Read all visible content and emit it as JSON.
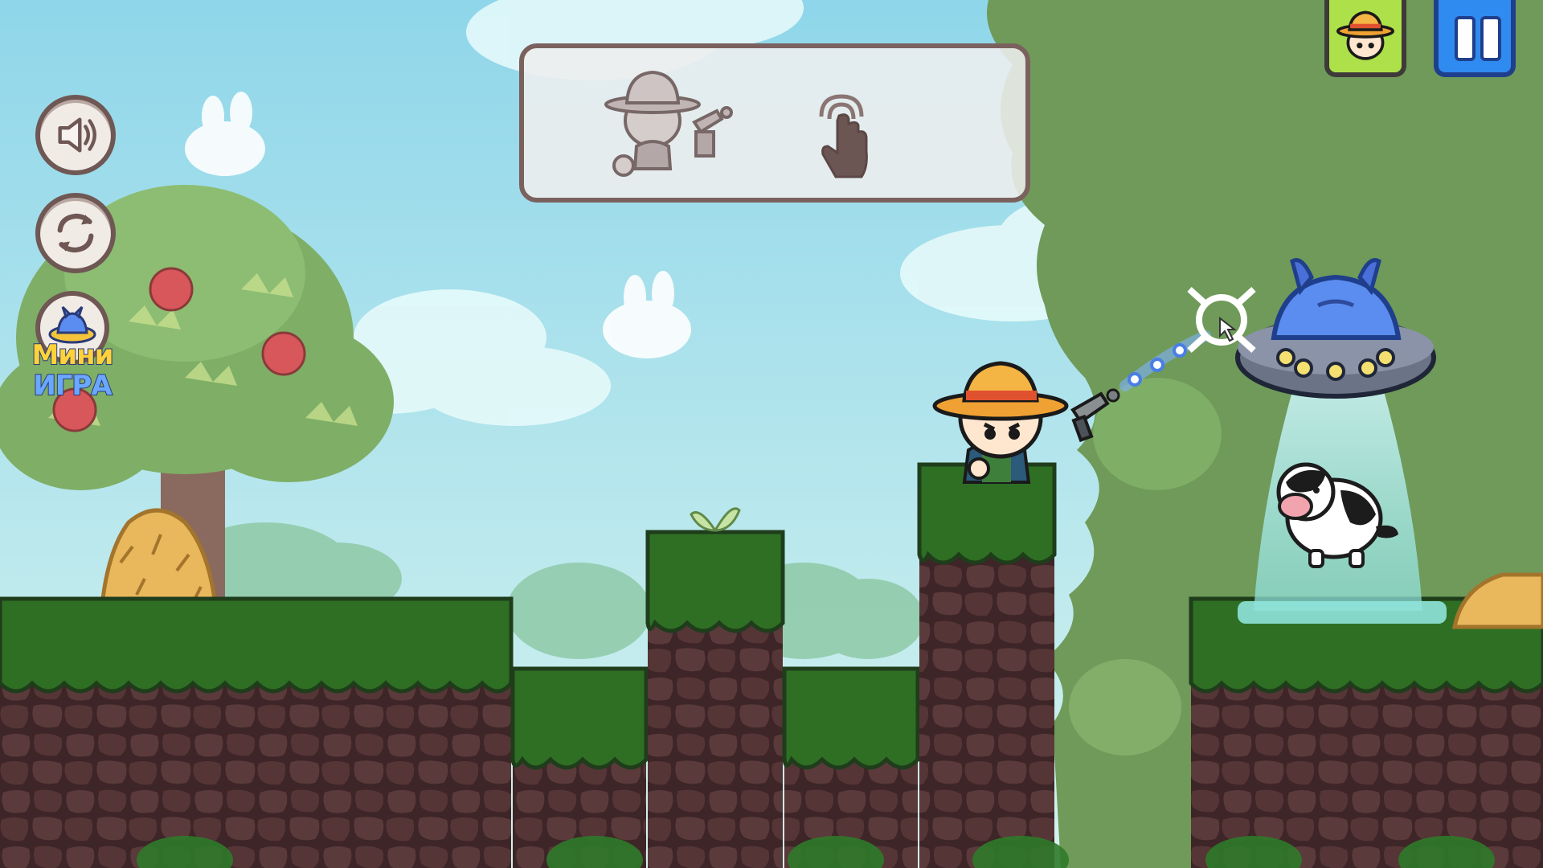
{
  "hud": {
    "sound_icon": "speaker-icon",
    "restart_icon": "refresh-icon",
    "minigame": {
      "line1": "Мини",
      "line2": "ИГРА",
      "icon": "ufo-icon"
    },
    "character_icon": "farmer-avatar-icon",
    "pause_icon": "pause-icon"
  },
  "tutorial": {
    "icons": [
      "farmer-with-raygun-icon",
      "tap-hand-icon"
    ]
  },
  "colors": {
    "sky_top": "#8fd6ea",
    "sky_bottom": "#d5f3ef",
    "grass": "#2e6f24",
    "soil": "#4a2d2d",
    "hud_border": "#6f5754",
    "ufo": "#5b8cf0",
    "foliage": "#6f9a59"
  }
}
